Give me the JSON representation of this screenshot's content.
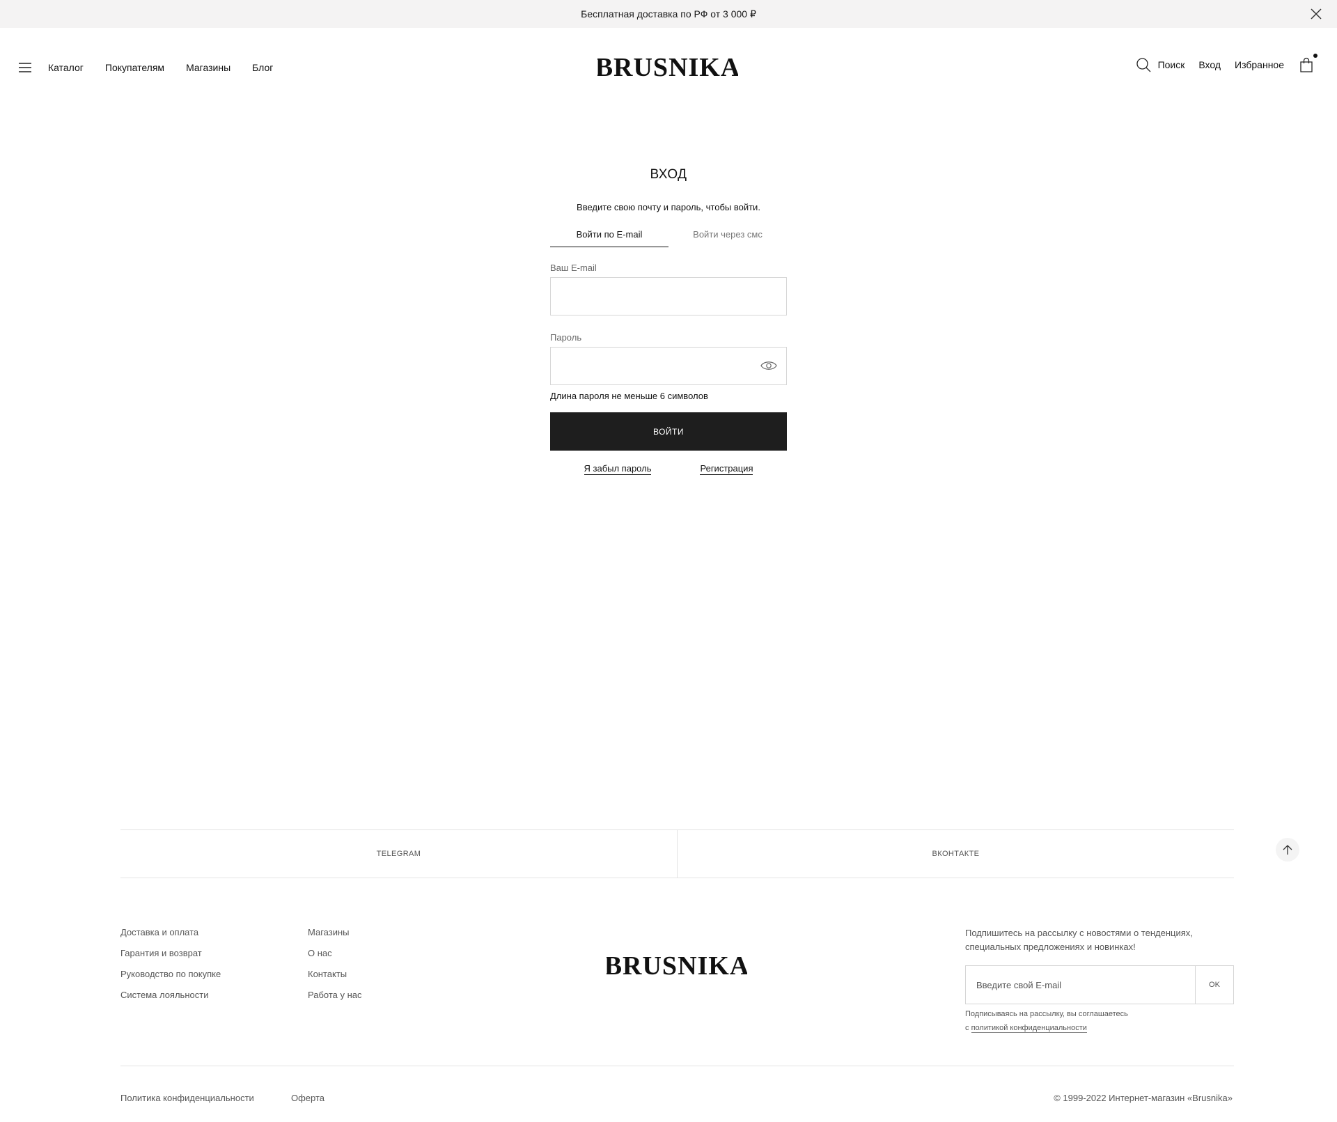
{
  "promo": {
    "text": "Бесплатная доставка по РФ от 3 000 ₽"
  },
  "header": {
    "nav": [
      "Каталог",
      "Покупателям",
      "Магазины",
      "Блог"
    ],
    "logo": "BRUSNIKA",
    "search_label": "Поиск",
    "login_label": "Вход",
    "favorites_label": "Избранное"
  },
  "login": {
    "title": "ВХОД",
    "intro": "Введите свою почту и пароль, чтобы войти.",
    "tabs": [
      "Войти по E-mail",
      "Войти через смс"
    ],
    "active_tab": 0,
    "email_label": "Ваш E-mail",
    "email_value": "",
    "password_label": "Пароль",
    "password_value": "",
    "password_hint": "Длина пароля не меньше 6 символов",
    "submit_label": "ВОЙТИ",
    "forgot_label": "Я забыл пароль",
    "register_label": "Регистрация"
  },
  "social": {
    "telegram": "TELEGRAM",
    "vk": "ВКОНТАКТЕ"
  },
  "footer": {
    "col1": [
      "Доставка и оплата",
      "Гарантия и возврат",
      "Руководство по покупке",
      "Система лояльности"
    ],
    "col2": [
      "Магазины",
      "О нас",
      "Контакты",
      "Работа у нас"
    ],
    "logo": "BRUSNIKA",
    "subscribe_text": "Подпишитесь на рассылку с новостями о тенденциях, специальных предложениях и новинках!",
    "subscribe_placeholder": "Введите свой E-mail",
    "subscribe_button": "OK",
    "consent_text": "Подписываясь на рассылку, вы соглашаетесь",
    "consent_prefix": "с",
    "consent_link": "политикой конфиденциальности",
    "privacy": "Политика конфиденциальности",
    "offer": "Оферта",
    "copyright": "© 1999-2022 Интернет-магазин «Brusnika»"
  },
  "colors": {
    "background": "#ffffff",
    "promo_bg": "#f4f3f3",
    "button_bg": "#1e1e1e",
    "border": "#d6d6d6"
  },
  "icons": [
    "close-icon",
    "burger-menu-icon",
    "search-icon",
    "cart-icon",
    "eye-icon",
    "arrow-up-icon"
  ]
}
